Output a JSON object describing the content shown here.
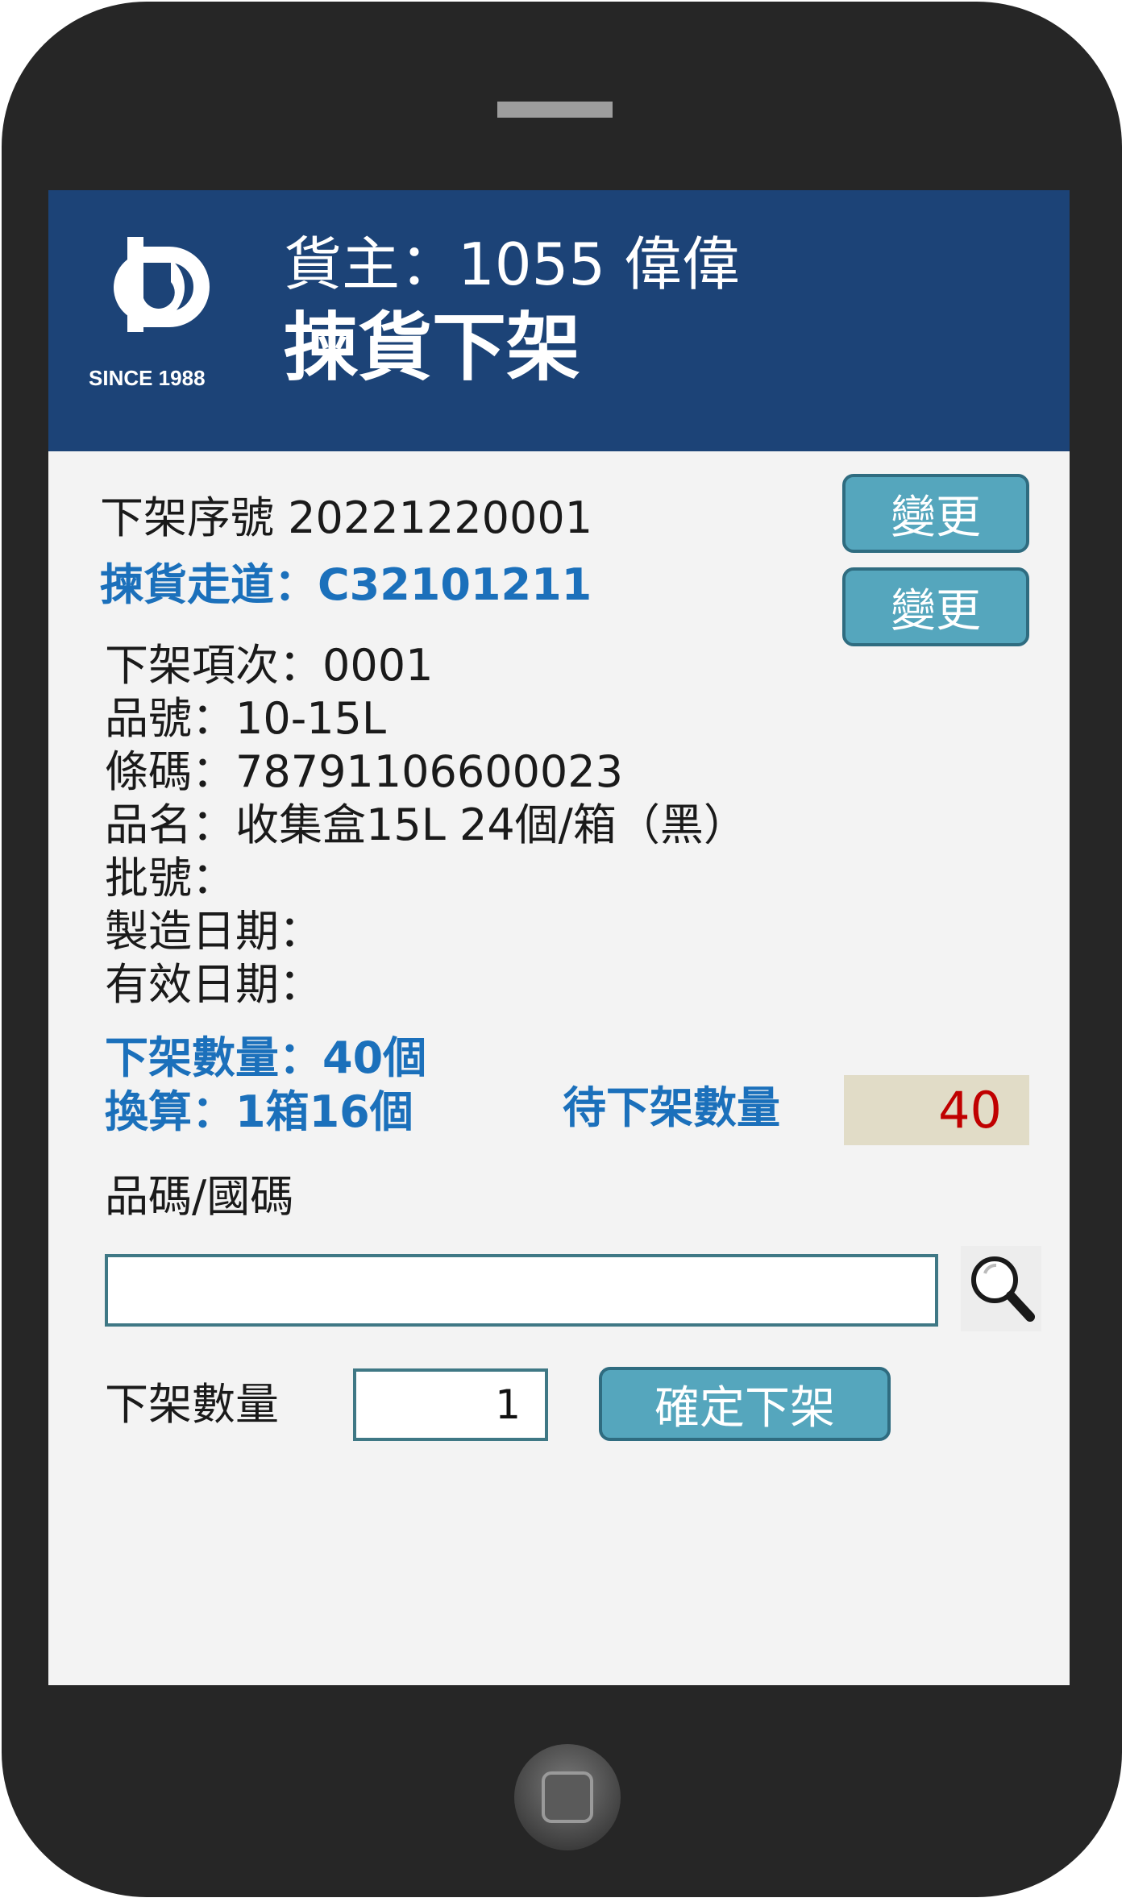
{
  "header": {
    "logo_text": "SINCE 1988",
    "owner": "貨主：1055 偉偉",
    "title": "揀貨下架"
  },
  "order": {
    "serial": "下架序號 20221220001",
    "aisle": "揀貨走道：C32101211",
    "change_label_1": "變更",
    "change_label_2": "變更"
  },
  "item": {
    "line_no": "下架項次：0001",
    "part_no": "品號：10-15L",
    "barcode": "條碼：78791106600023",
    "name": "品名：收集盒15L 24個/箱（黑）",
    "lot_no": "批號：",
    "mfg_date": "製造日期：",
    "exp_date": "有效日期："
  },
  "quantity": {
    "pick_qty": "下架數量：40個",
    "conversion": "換算：1箱16個",
    "remaining_label": "待下架數量",
    "remaining_value": "40"
  },
  "scan": {
    "label": "品碼/國碼",
    "value": "",
    "search_icon": "magnifier-icon"
  },
  "confirm": {
    "qty_label": "下架數量",
    "qty_value": "1",
    "button_label": "確定下架"
  },
  "colors": {
    "header_bg": "#1c4377",
    "accent_blue": "#1b70bb",
    "button_bg": "#55a6bd",
    "remaining_bg": "#e1dcc7",
    "remaining_text": "#c00000",
    "phone_body": "#262626"
  }
}
